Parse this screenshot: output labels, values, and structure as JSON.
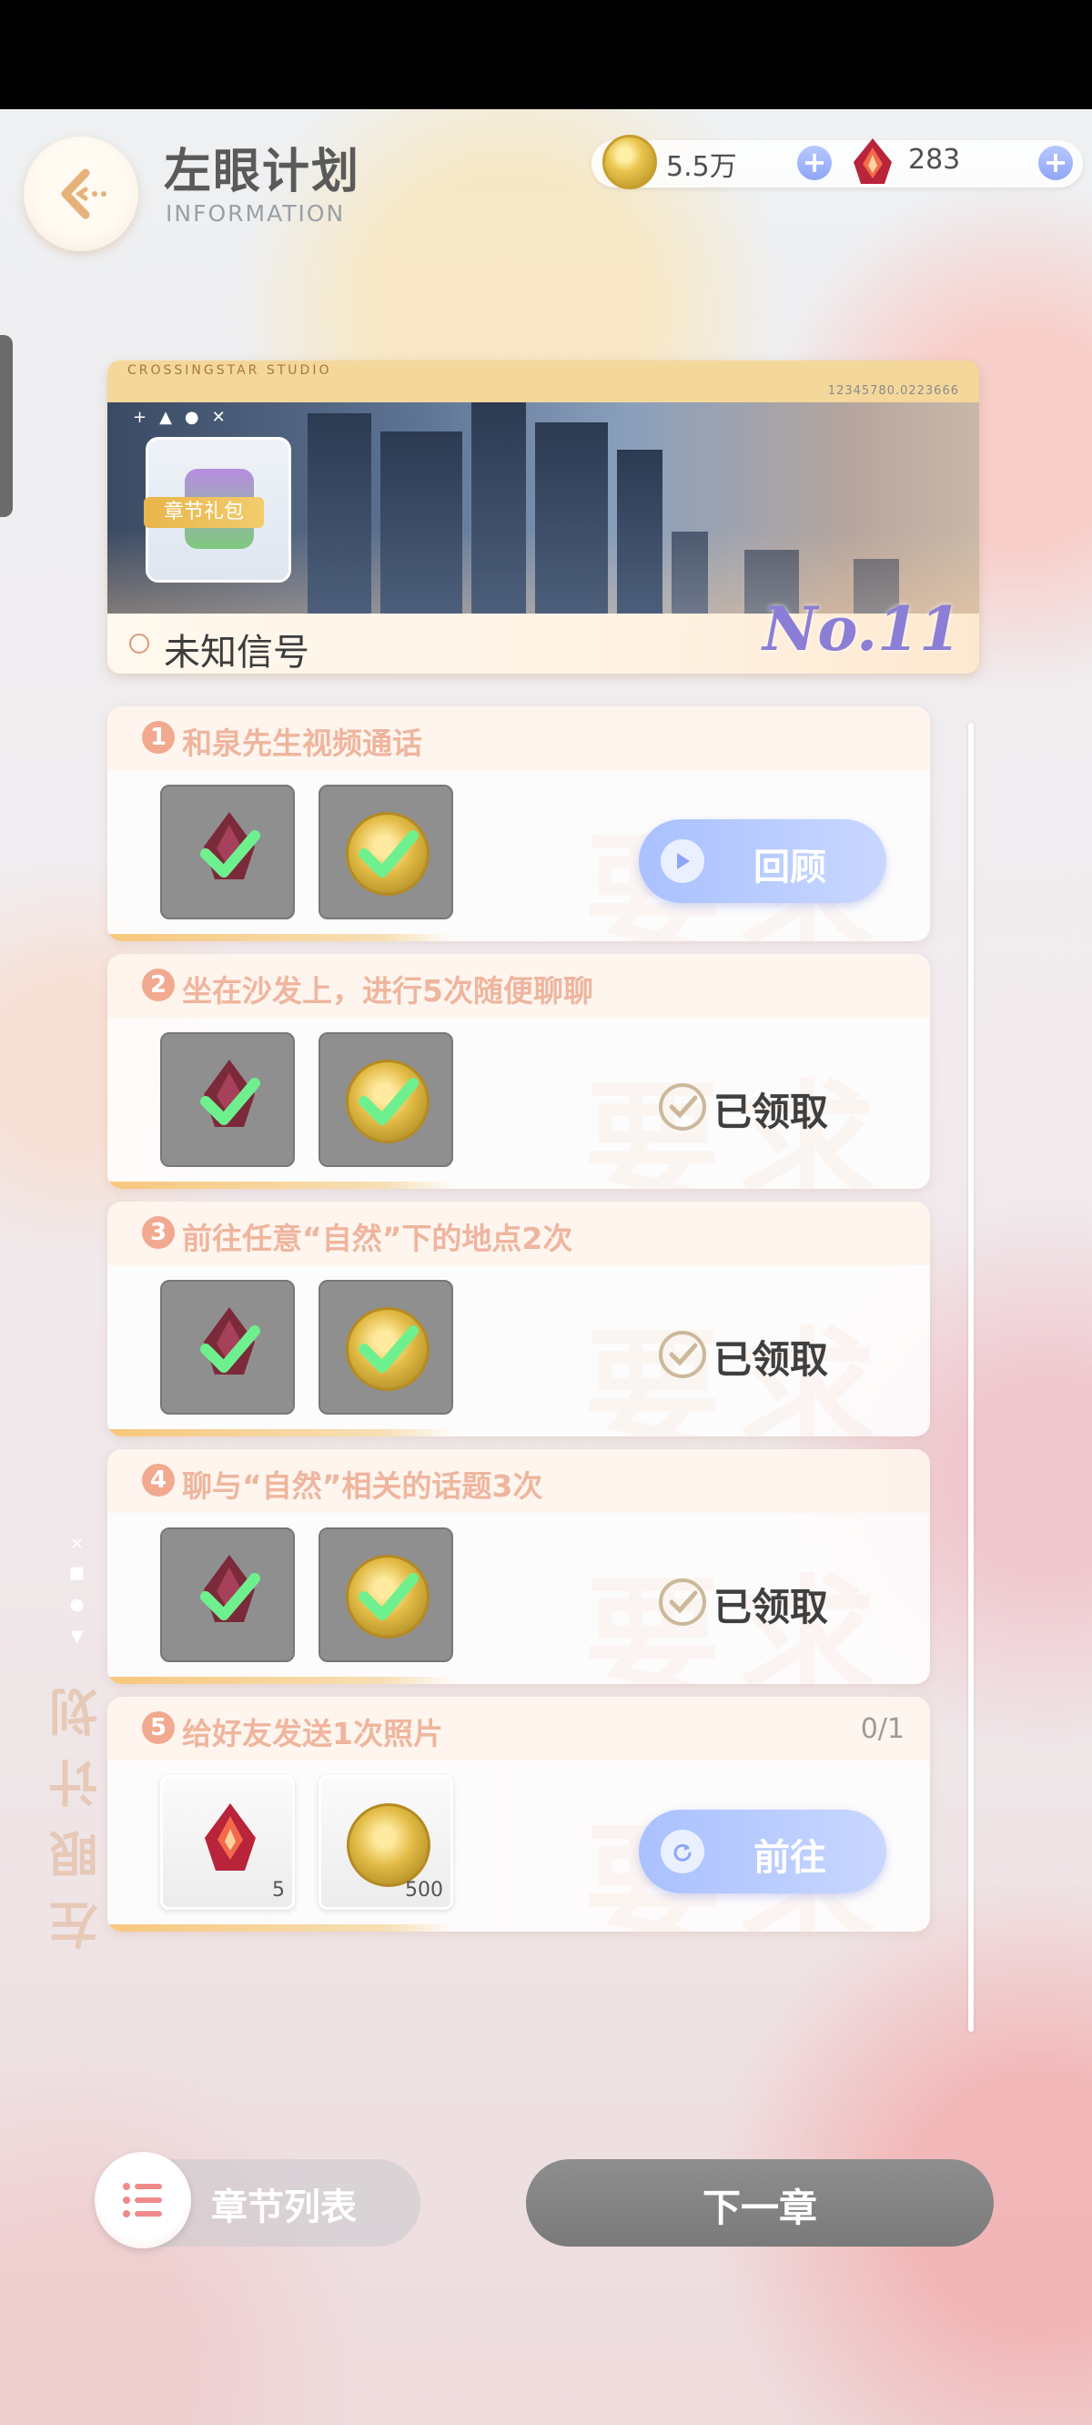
{
  "header": {
    "title": "左眼计划",
    "subtitle": "INFORMATION"
  },
  "currency": {
    "coins": "5.5万",
    "gems": "283",
    "coin_icon": "gold-coin-icon",
    "gem_icon": "red-crystal-icon"
  },
  "banner": {
    "studio": "CROSSINGSTAR STUDIO",
    "code": "12345780.0223666",
    "gift_label": "章节礼包",
    "chapter_name": "未知信号",
    "chapter_no": "No.11"
  },
  "side_title": "左眼计划",
  "tasks": [
    {
      "num": "1",
      "title": "和泉先生视频通话",
      "progress": "",
      "status": "review",
      "button": "回顾"
    },
    {
      "num": "2",
      "title": "坐在沙发上，进行5次随便聊聊",
      "progress": "",
      "status": "claimed",
      "button": "已领取"
    },
    {
      "num": "3",
      "title": "前往任意“自然”下的地点2次",
      "progress": "",
      "status": "claimed",
      "button": "已领取"
    },
    {
      "num": "4",
      "title": "聊与“自然”相关的话题3次",
      "progress": "",
      "status": "claimed",
      "button": "已领取"
    },
    {
      "num": "5",
      "title": "给好友发送1次照片",
      "progress": "0/1",
      "status": "go",
      "button": "前往",
      "rewards": [
        {
          "icon": "red-crystal-icon",
          "qty": "5"
        },
        {
          "icon": "gold-coin-icon",
          "qty": "500"
        }
      ]
    }
  ],
  "bottom": {
    "chapter_list": "章节列表",
    "next_chapter": "下一章"
  },
  "colors": {
    "accent_blue": "#a9c1ff",
    "task_title": "#efb59e",
    "number_badge": "#f1a98f",
    "chapter_no": "#8b7ed6"
  }
}
